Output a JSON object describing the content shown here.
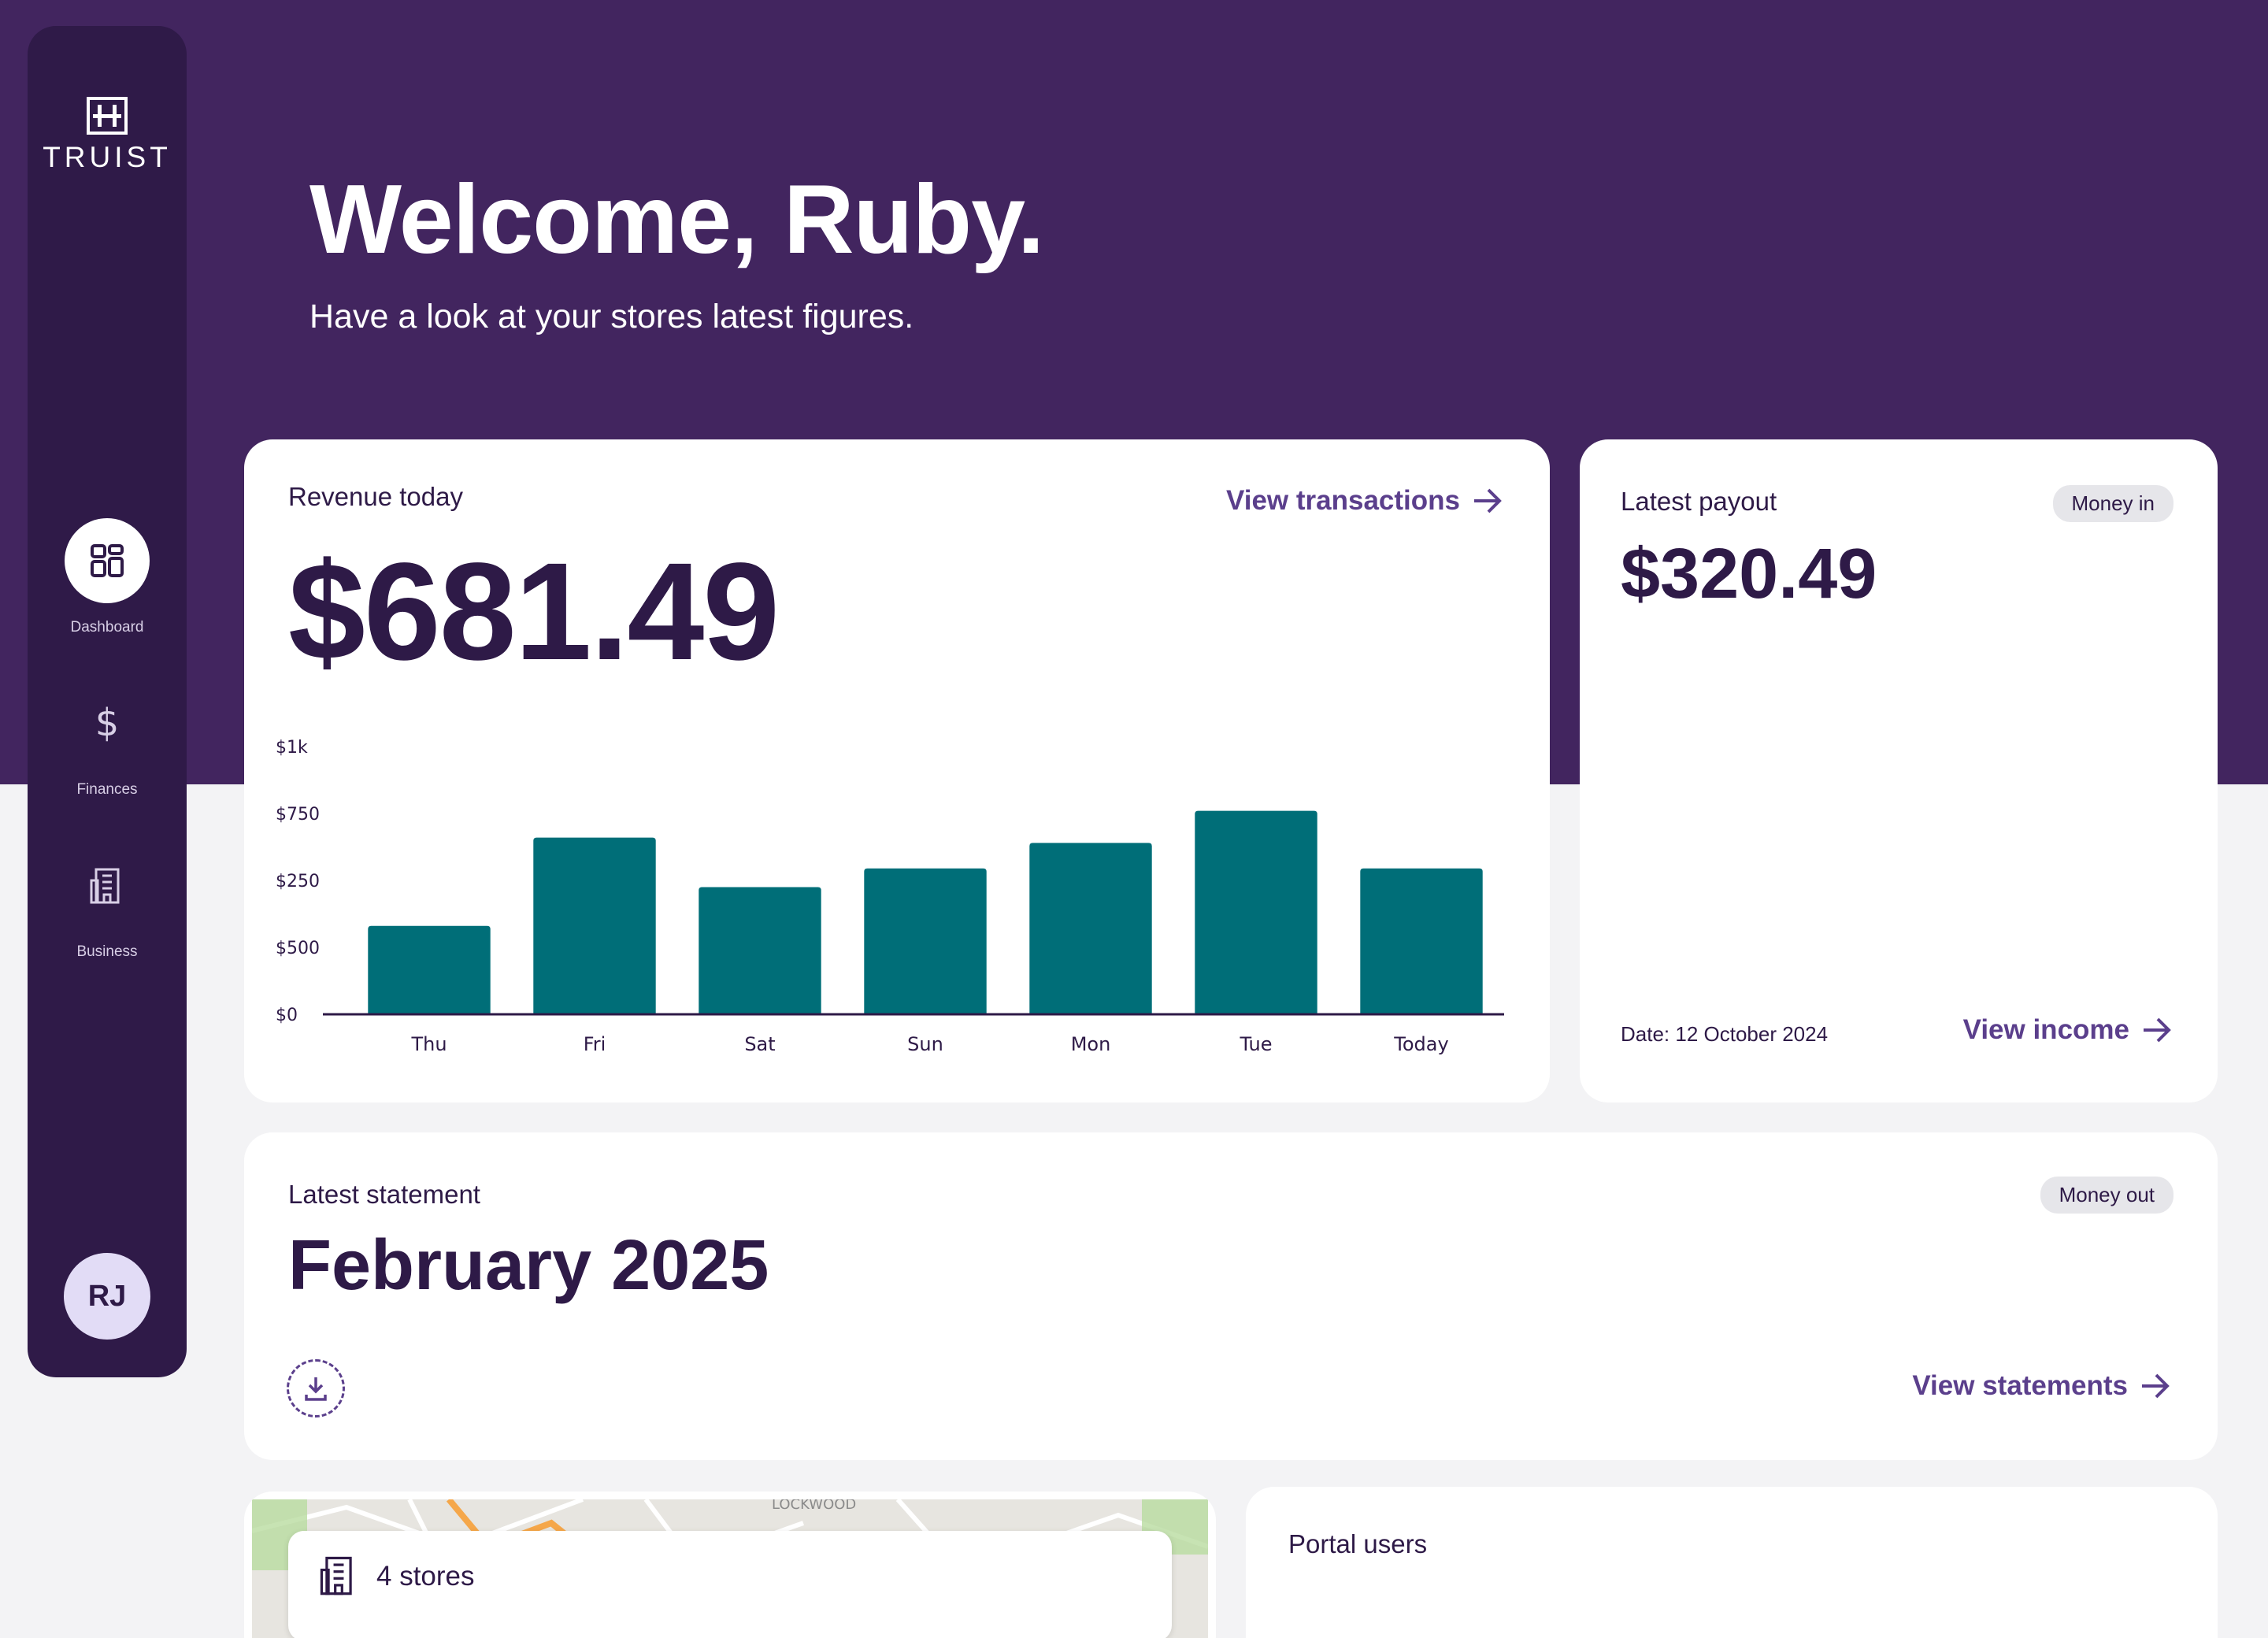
{
  "sidebar": {
    "brand": "TRUIST",
    "items": [
      {
        "label": "Dashboard",
        "icon": "dashboard-grid-icon",
        "active": true
      },
      {
        "label": "Finances",
        "icon": "dollar-icon",
        "active": false
      },
      {
        "label": "Business",
        "icon": "building-icon",
        "active": false
      }
    ],
    "avatar_initials": "RJ"
  },
  "welcome": {
    "title": "Welcome, Ruby.",
    "subtitle": "Have a look at your stores latest figures."
  },
  "revenue": {
    "label": "Revenue today",
    "amount": "$681.49",
    "link": "View transactions"
  },
  "payout": {
    "label": "Latest payout",
    "badge": "Money in",
    "amount": "$320.49",
    "date": "Date: 12 October 2024",
    "link": "View income"
  },
  "statement": {
    "label": "Latest statement",
    "badge": "Money out",
    "title": "February 2025",
    "link": "View statements"
  },
  "stores": {
    "label": "4 stores",
    "map_place": "LOCKWOOD"
  },
  "users": {
    "label": "Portal users"
  },
  "colors": {
    "hero": "#42255f",
    "sidebar": "#2f1a48",
    "accent": "#5b3f8c",
    "bar": "#006e78",
    "text": "#2e1a47"
  },
  "chart_data": {
    "type": "bar",
    "categories": [
      "Thu",
      "Fri",
      "Sat",
      "Sun",
      "Mon",
      "Tue",
      "Today"
    ],
    "values": [
      330,
      660,
      475,
      545,
      640,
      760,
      545
    ],
    "ylim": [
      0,
      1000
    ],
    "yticks": [
      "$0",
      "$500",
      "$250",
      "$750",
      "$1k"
    ],
    "grid": false
  }
}
